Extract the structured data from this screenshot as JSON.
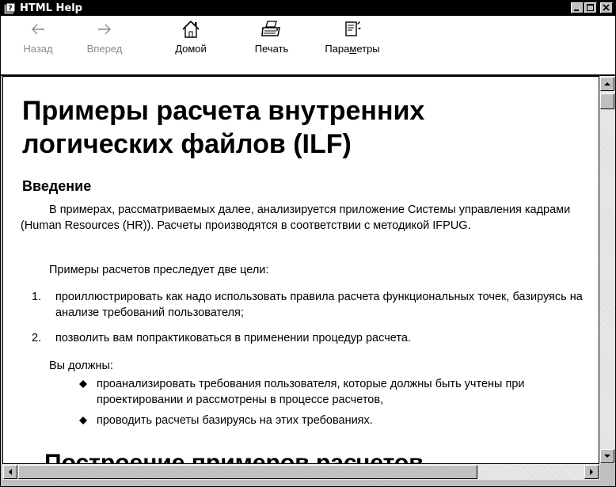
{
  "window": {
    "title": "HTML Help",
    "icon": "help-book-icon",
    "controls": [
      "minimize-icon",
      "maximize-icon",
      "close-icon"
    ]
  },
  "toolbar": {
    "buttons": [
      {
        "label": "Назад",
        "icon": "back-arrow-icon",
        "enabled": false
      },
      {
        "label": "Вперед",
        "icon": "forward-arrow-icon",
        "enabled": false
      },
      {
        "label": "Домой",
        "icon": "home-icon",
        "enabled": true
      },
      {
        "label": "Печать",
        "icon": "printer-icon",
        "enabled": true
      },
      {
        "label": "Параметры",
        "icon": "options-icon",
        "enabled": true
      }
    ]
  },
  "content": {
    "title": "Примеры расчета внутренних логических файлов (ILF)",
    "section_heading": "Введение",
    "intro": "В примерах, рассматриваемых далее, анализируется приложение Системы управления кадрами (Human Resources (HR)). Расчеты производятся в соответствии с методикой IFPUG.",
    "goals_lead": "Примеры расчетов преследует две цели:",
    "goals": [
      {
        "num": "1.",
        "text": "проиллюстрировать как надо использовать правила расчета функциональных точек, базируясь на анализе требований пользователя;"
      },
      {
        "num": "2.",
        "text": "позволить вам попрактиковаться в применении процедур расчета."
      }
    ],
    "must_lead": "Вы должны:",
    "musts": [
      "проанализировать требования пользователя, которые должны быть учтены при проектировании и рассмотрены в процессе расчетов,",
      "проводить расчеты базируясь на этих требованиях."
    ],
    "next_heading": "Построение примеров расчетов"
  }
}
